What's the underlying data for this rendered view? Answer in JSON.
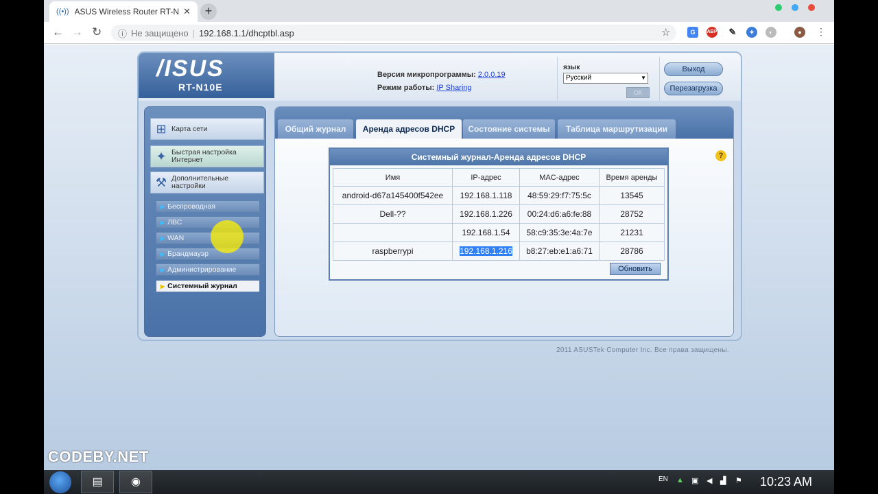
{
  "browser": {
    "tab_title": "ASUS Wireless Router RT-N10E",
    "new_tab": "+",
    "security": "Не защищено",
    "url": "192.168.1.1/dhcptbl.asp"
  },
  "router": {
    "logo": "/ISUS",
    "model": "RT-N10E",
    "firmware_label": "Версия микропрограммы:",
    "firmware_version": "2.0.0.19",
    "mode_label": "Режим работы:",
    "mode_value": "IP Sharing",
    "lang_label": "язык",
    "lang_value": "Русский",
    "apply_label": "ОК",
    "logout": "Выход",
    "reboot": "Перезагрузка"
  },
  "menu": {
    "big_items": [
      {
        "label": "Карта сети"
      },
      {
        "label": "Быстрая настройка Интернет"
      },
      {
        "label": "Дополнительные настройки"
      }
    ],
    "sub_items": [
      {
        "label": "Беспроводная"
      },
      {
        "label": "ЛВС"
      },
      {
        "label": "WAN"
      },
      {
        "label": "Брандмауэр"
      },
      {
        "label": "Администрирование"
      },
      {
        "label": "Системный журнал"
      }
    ]
  },
  "tabs": [
    {
      "label": "Общий журнал"
    },
    {
      "label": "Аренда адресов DHCP"
    },
    {
      "label": "Состояние системы"
    },
    {
      "label": "Таблица маршрутизации"
    }
  ],
  "dhcp": {
    "title": "Системный журнал-Аренда адресов DHCP",
    "columns": [
      "Имя",
      "IP-адрес",
      "MAC-адрес",
      "Время аренды"
    ],
    "rows": [
      {
        "name": "android-d67a145400f542ee",
        "ip": "192.168.1.118",
        "mac": "48:59:29:f7:75:5c",
        "lease": "13545"
      },
      {
        "name": "Dell-??",
        "ip": "192.168.1.226",
        "mac": "00:24:d6:a6:fe:88",
        "lease": "28752"
      },
      {
        "name": "",
        "ip": "192.168.1.54",
        "mac": "58:c9:35:3e:4a:7e",
        "lease": "21231"
      },
      {
        "name": "raspberrypi",
        "ip": "192.168.1.216",
        "mac": "b8:27:eb:e1:a6:71",
        "lease": "28786"
      }
    ],
    "refresh": "Обновить"
  },
  "footer": {
    "copyright": "2011 ASUSTek Computer Inc. Все права защищены."
  },
  "watermark": "CODEBY.NET",
  "taskbar": {
    "lang": "EN",
    "clock": "10:23 AM"
  },
  "colors": {
    "accent": "#4a72a8",
    "selection": "#2f7ff6"
  }
}
